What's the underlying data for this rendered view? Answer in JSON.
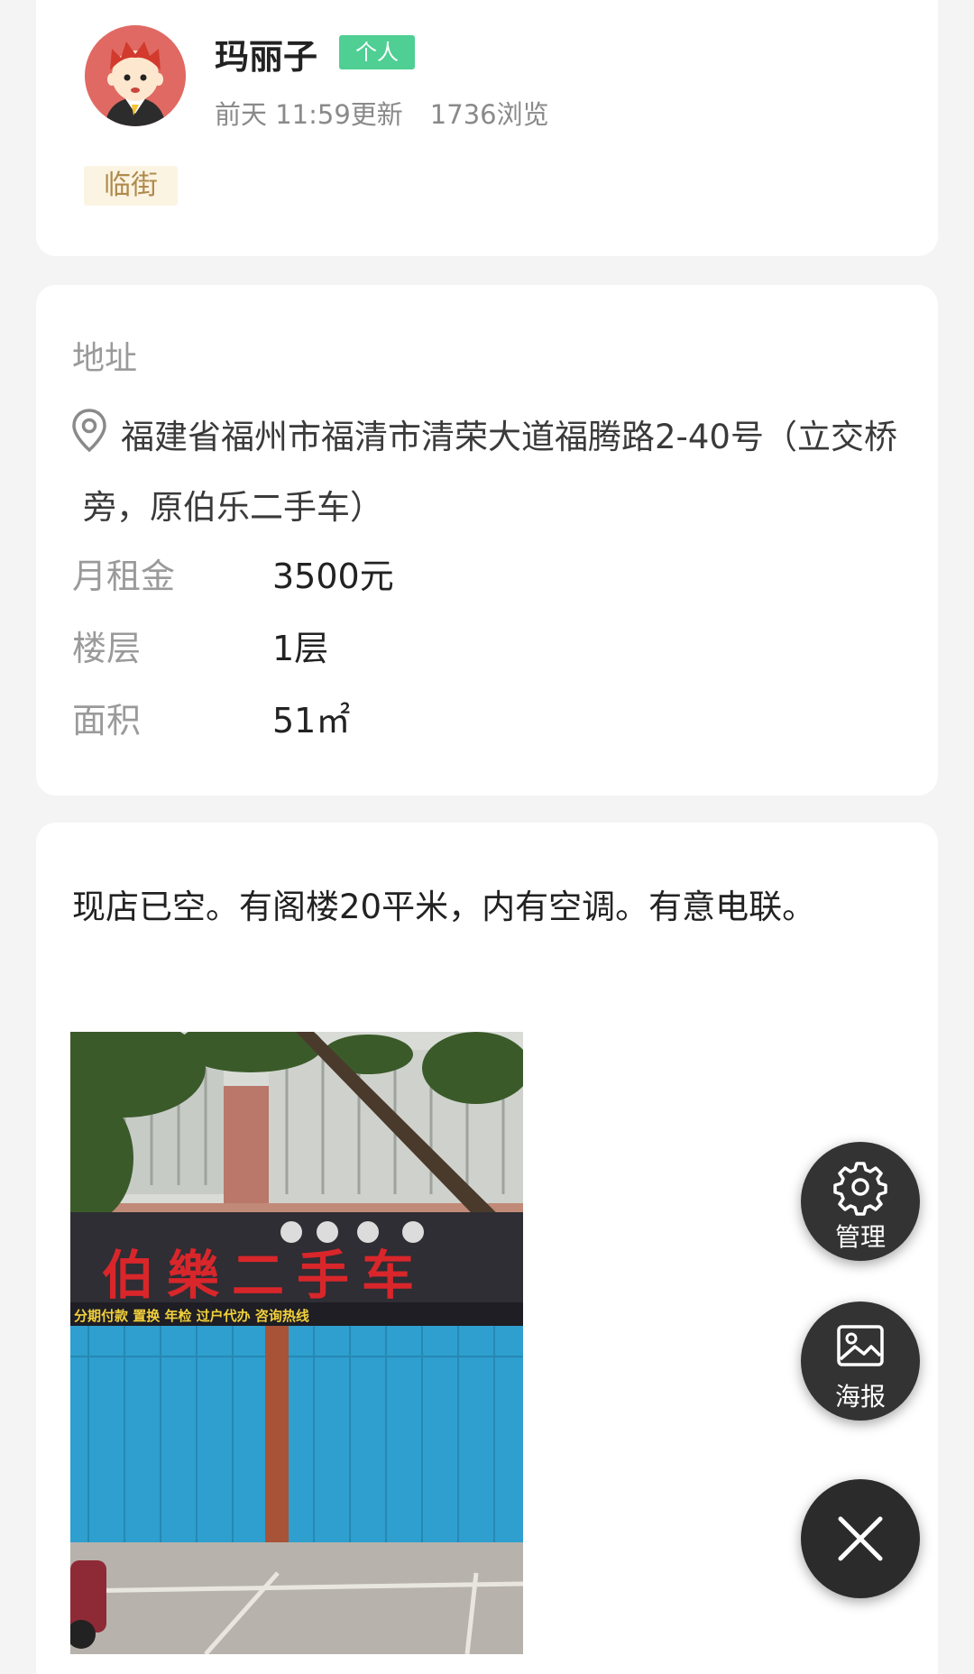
{
  "user": {
    "name": "玛丽子",
    "badge": "个人",
    "updated": "前天 11:59更新",
    "views": "1736浏览",
    "tag": "临街"
  },
  "info": {
    "address_label": "地址",
    "address": "福建省福州市福清市清荣大道福腾路2-40号（立交桥旁，原伯乐二手车）",
    "rows": [
      {
        "key": "月租金",
        "value": "3500元"
      },
      {
        "key": "楼层",
        "value": "1层"
      },
      {
        "key": "面积",
        "value": "51㎡"
      }
    ]
  },
  "description": {
    "text": "现店已空。有阁楼20平米，内有空调。有意电联。",
    "photo": {
      "sign_text": "伯樂二手车",
      "sign_subtext": "分期付款 置换 年检 过户代办   咨询热线"
    }
  },
  "actions": {
    "manage_label": "管理",
    "poster_label": "海报"
  },
  "icons": {
    "manage": "gear-icon",
    "poster": "image-icon",
    "close": "close-icon",
    "address": "location-pin-icon"
  },
  "colors": {
    "badge_green": "#4fcf94",
    "tag_bg": "#fbf4e3",
    "tag_text": "#b08a4c",
    "fab_bg": "#333333"
  }
}
